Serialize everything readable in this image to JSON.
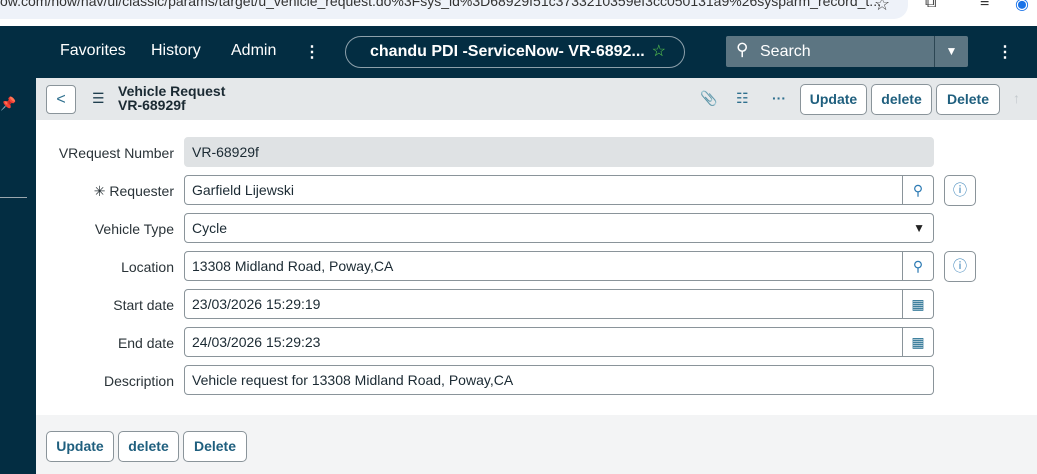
{
  "browser": {
    "url": "ow.com/now/nav/ui/classic/params/target/u_vehicle_request.do%3Fsys_id%3D68929f51c3733210359ef3cc050131a9%26sysparm_record_t..."
  },
  "nav": {
    "favorites": "Favorites",
    "history": "History",
    "admin": "Admin",
    "more": "⋮",
    "instance_title": "chandu PDI -ServiceNow- VR-6892...",
    "search_placeholder": "Search",
    "menu": "⋮"
  },
  "header": {
    "table": "Vehicle Request",
    "record": "VR-68929f",
    "buttons": [
      "Update",
      "delete",
      "Delete"
    ]
  },
  "form": {
    "number": {
      "label": "VRequest Number",
      "value": "VR-68929f"
    },
    "requester": {
      "label": "Requester",
      "value": "Garfield Lijewski",
      "required_mark": "✳"
    },
    "vehicle_type": {
      "label": "Vehicle Type",
      "value": "Cycle"
    },
    "location": {
      "label": "Location",
      "value": "13308 Midland Road, Poway,CA"
    },
    "start_date": {
      "label": "Start date",
      "value": "23/03/2026 15:29:19"
    },
    "end_date": {
      "label": "End date",
      "value": "24/03/2026 15:29:23"
    },
    "description": {
      "label": "Description",
      "value": "Vehicle request for 13308 Midland Road, Poway,CA"
    }
  },
  "footer": {
    "buttons": [
      "Update",
      "delete",
      "Delete"
    ]
  }
}
